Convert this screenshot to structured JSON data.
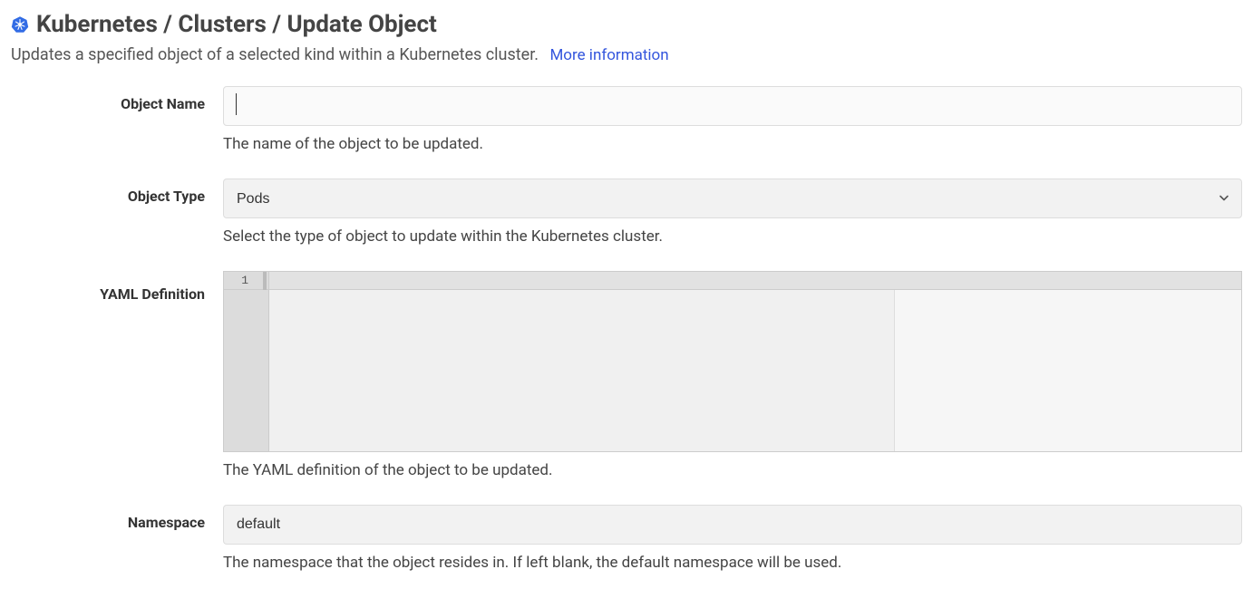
{
  "header": {
    "title": "Kubernetes / Clusters / Update Object",
    "description": "Updates a specified object of a selected kind within a Kubernetes cluster.",
    "more_info_label": "More information",
    "icon_color": "#326ce5"
  },
  "fields": {
    "object_name": {
      "label": "Object Name",
      "value": "",
      "help": "The name of the object to be updated."
    },
    "object_type": {
      "label": "Object Type",
      "value": "Pods",
      "help": "Select the type of object to update within the Kubernetes cluster."
    },
    "yaml_definition": {
      "label": "YAML Definition",
      "line_number": "1",
      "value": "",
      "help": "The YAML definition of the object to be updated."
    },
    "namespace": {
      "label": "Namespace",
      "value": "default",
      "help": "The namespace that the object resides in. If left blank, the default namespace will be used."
    }
  }
}
